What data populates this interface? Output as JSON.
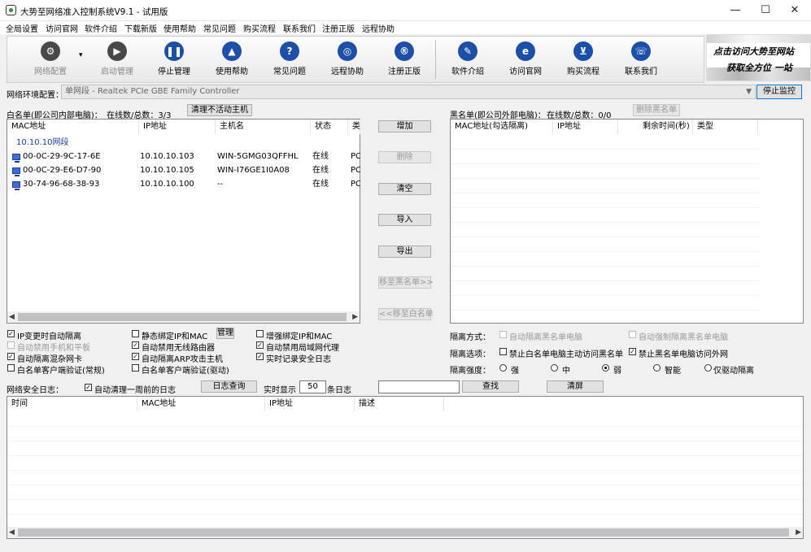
{
  "window": {
    "title": "大势至网络准入控制系统V9.1 - 试用版",
    "minimize": "—",
    "maximize": "☐",
    "close": "✕"
  },
  "menu": [
    "全局设置",
    "访问官网",
    "软件介绍",
    "下载新版",
    "使用帮助",
    "常见问题",
    "购买流程",
    "联系我们",
    "注册正版",
    "远程协助"
  ],
  "toolbar": {
    "buttons": [
      {
        "label": "网络配置",
        "icon": "gear-icon",
        "glyph": "⚙",
        "color": "#2b2b2b",
        "disabled": true
      },
      {
        "label": "启动管理",
        "icon": "play-icon",
        "glyph": "▶",
        "color": "#2b2b2b",
        "disabled": true
      },
      {
        "label": "停止管理",
        "icon": "pause-icon",
        "glyph": "❚❚",
        "color": "#1c4fa8",
        "disabled": false
      },
      {
        "label": "使用帮助",
        "icon": "graduation-cap-icon",
        "glyph": "▲",
        "color": "#1c4fa8",
        "disabled": false
      },
      {
        "label": "常见问题",
        "icon": "question-icon",
        "glyph": "?",
        "color": "#1c4fa8",
        "disabled": false
      },
      {
        "label": "远程协助",
        "icon": "globe-icon",
        "glyph": "◎",
        "color": "#1c4fa8",
        "disabled": false
      },
      {
        "label": "注册正版",
        "icon": "registered-icon",
        "glyph": "®",
        "color": "#1c4fa8",
        "disabled": false
      },
      {
        "label": "软件介绍",
        "icon": "edit-icon",
        "glyph": "✎",
        "color": "#1c4fa8",
        "disabled": false
      },
      {
        "label": "访问官网",
        "icon": "browser-icon",
        "glyph": "e",
        "color": "#1c4fa8",
        "disabled": false
      },
      {
        "label": "购买流程",
        "icon": "cart-icon",
        "glyph": "⊻",
        "color": "#1c4fa8",
        "disabled": false
      },
      {
        "label": "联系我们",
        "icon": "phone-icon",
        "glyph": "☏",
        "color": "#1c4fa8",
        "disabled": false
      }
    ],
    "dropdown_glyph": "▾"
  },
  "banner": {
    "line1": "点击访问大势至网站",
    "line2": "获取全方位 一站"
  },
  "network": {
    "label": "网络环境配置：",
    "value": "单网段 - Realtek PCIe GBE Family Controller",
    "stop_button": "停止监控"
  },
  "whitelist": {
    "title": "白名单(即公司内部电脑)：",
    "stats": "在线数/总数：3/3",
    "clear_inactive": "清理不活动主机",
    "columns": [
      "MAC地址",
      "IP地址",
      "主机名",
      "状态",
      "类"
    ],
    "group": "10.10.10网段",
    "rows": [
      {
        "mac": "00-0C-29-9C-17-6E",
        "ip": "10.10.10.103",
        "host": "WIN-5GMG03QFFHL",
        "status": "在线",
        "type": "PC"
      },
      {
        "mac": "00-0C-29-E6-D7-90",
        "ip": "10.10.10.105",
        "host": "WIN-I76GE1I0A08",
        "status": "在线",
        "type": "PC"
      },
      {
        "mac": "30-74-96-68-38-93",
        "ip": "10.10.10.100",
        "host": "--",
        "status": "在线",
        "type": "PC"
      }
    ]
  },
  "middle_buttons": {
    "add": "增加",
    "delete": "删除",
    "clear": "清空",
    "import": "导入",
    "export": "导出",
    "to_black": "移至黑名单>>",
    "to_white": "<<移至白名单"
  },
  "blacklist": {
    "title": "黑名单(即公司外部电脑)：",
    "stats": "在线数/总数：0/0",
    "delete_button": "删除黑名单",
    "columns": [
      "MAC地址(勾选隔离)",
      "IP地址",
      "剩余时间(秒)",
      "类型"
    ]
  },
  "options": {
    "ip_change_isolate": "IP变更时自动隔离",
    "disable_phone": "自动禁用手机和平板",
    "isolate_mixed_nic": "自动隔离混杂网卡",
    "whitelist_client_normal": "白名单客户端验证(常规)",
    "static_bind": "静态绑定IP和MAC",
    "manage_button": "管理",
    "disable_wireless_router": "自动禁用无线路由器",
    "isolate_arp": "自动隔离ARP攻击主机",
    "whitelist_client_driver": "白名单客户端验证(驱动)",
    "enhanced_bind": "增强绑定IP和MAC",
    "disable_lan_proxy": "自动禁用局域网代理",
    "realtime_log": "实时记录安全日志"
  },
  "isolation": {
    "mode_label": "隔离方式：",
    "mode_auto": "自动隔离黑名单电脑",
    "mode_force": "自动强制隔离黑名单电脑",
    "option_label": "隔离选项：",
    "opt_forbid_white": "禁止白名单电脑主动访问黑名单",
    "opt_forbid_black": "禁止黑名单电脑访问外网",
    "strength_label": "隔离强度：",
    "strength": [
      "强",
      "中",
      "弱",
      "智能",
      "仅驱动隔离"
    ],
    "strength_selected": "弱"
  },
  "log": {
    "label": "网络安全日志：",
    "auto_clean": "自动清理一周前的日志",
    "query_button": "日志查询",
    "realtime_prefix": "实时显示",
    "count": "50",
    "realtime_suffix": "条日志",
    "search_value": "",
    "find_button": "查找",
    "clear_button": "清屏",
    "columns": [
      "时间",
      "MAC地址",
      "IP地址",
      "描述"
    ]
  }
}
